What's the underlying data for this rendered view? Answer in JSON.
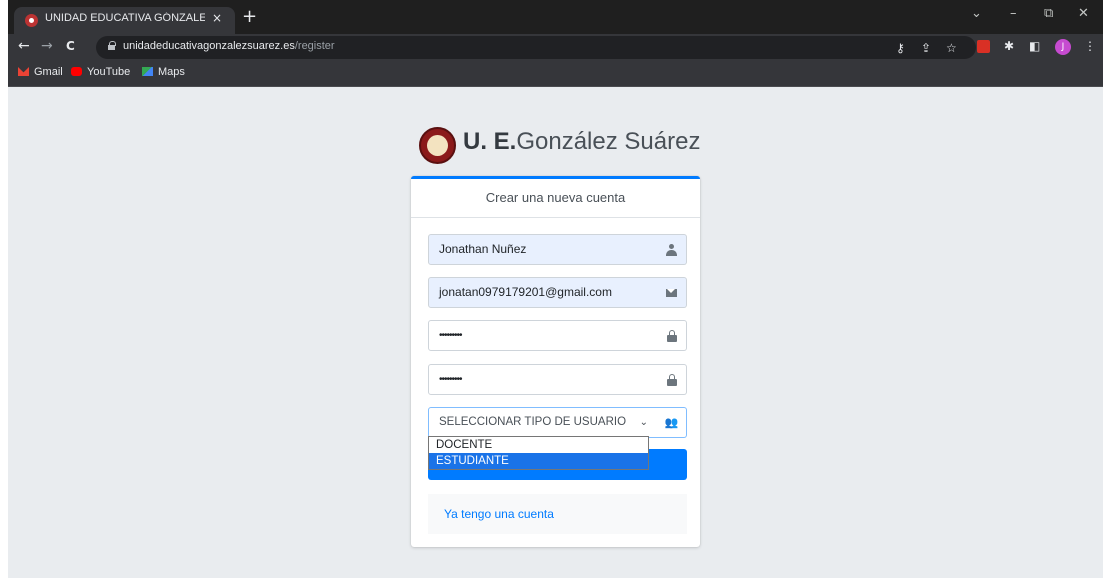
{
  "browser": {
    "tab_title": "UNIDAD EDUCATIVA GÓNZALEZ",
    "tab_close": "×",
    "new_tab": "+",
    "url_host": "unidadeducativagonzalezsuarez.es",
    "url_path": "/register",
    "nav": {
      "back": "←",
      "forward": "→",
      "reload": "C"
    },
    "window": {
      "dropdown": "⌄",
      "minimize": "–",
      "restore": "⧉",
      "close": "✕"
    },
    "toolbar_icons": {
      "key": "⚷",
      "share": "⇪",
      "star": "☆",
      "extensions": "✱",
      "sidepanel": "◧",
      "menu": "⋮"
    },
    "avatar_letter": "J",
    "bookmarks": [
      {
        "label": "Gmail",
        "color": "#ea4335"
      },
      {
        "label": "YouTube",
        "color": "#ff0000"
      },
      {
        "label": "Maps",
        "color": "#34a853"
      }
    ]
  },
  "page": {
    "brand_bold": "U. E.",
    "brand_rest": "González Suárez",
    "card_title": "Crear una nueva cuenta",
    "fields": {
      "name": "Jonathan Nuñez",
      "email": "jonatan0979179201@gmail.com",
      "password": "•••••••••",
      "password_confirm": "•••••••••"
    },
    "user_type_select": {
      "value": "SELECCIONAR TIPO DE USUARIO",
      "chevron": "⌄",
      "options": [
        "DOCENTE",
        "ESTUDIANTE"
      ],
      "highlighted": "ESTUDIANTE"
    },
    "users_icon": "👥",
    "login_link": "Ya tengo una cuenta"
  },
  "colors": {
    "primary": "#007bff",
    "autofill": "#e8f0fe",
    "highlight": "#1a73e8"
  }
}
